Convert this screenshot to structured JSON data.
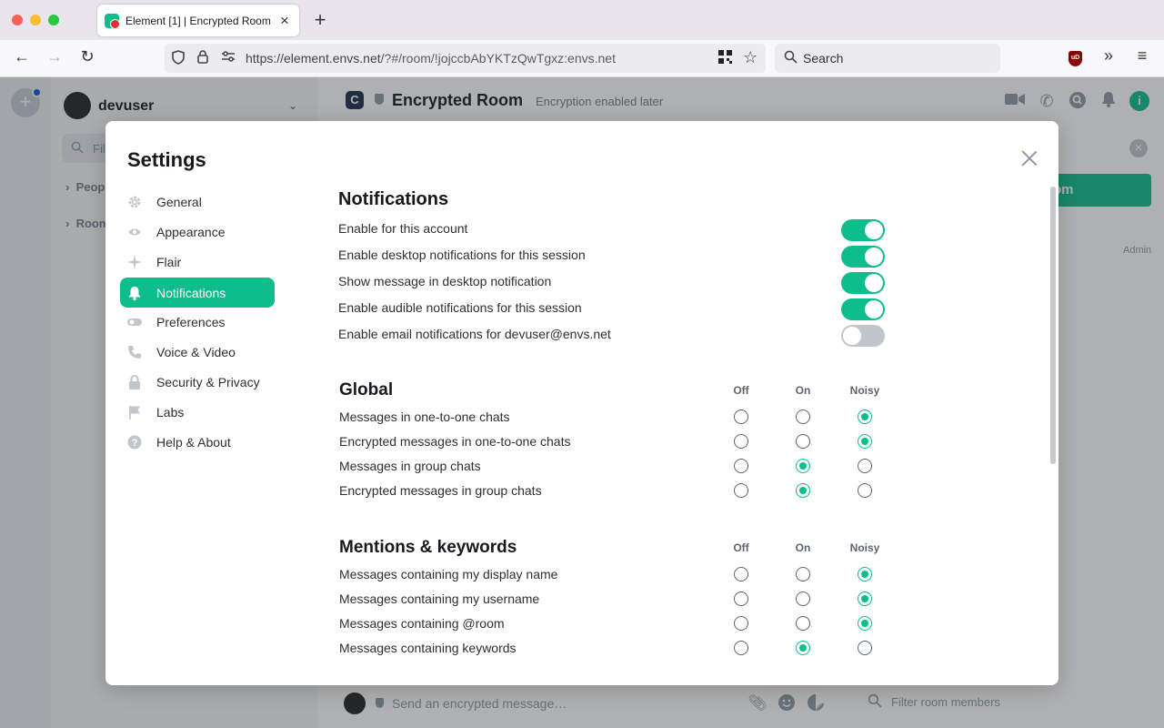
{
  "browser": {
    "tab_title": "Element [1] | Encrypted Room",
    "url_host": "https://element.envs.net",
    "url_path": "/?#/room/!jojccbAbYKTzQwTgxz:envs.net",
    "search_placeholder": "Search",
    "ublock_label": "uD"
  },
  "app": {
    "user_name": "devuser",
    "filter_placeholder": "Fil",
    "sections": [
      "Peop",
      "Room"
    ],
    "room_initial": "C",
    "room_name": "Encrypted Room",
    "room_topic": "Encryption enabled later",
    "right_button": "om",
    "admin_label": "Admin",
    "composer_placeholder": "Send an encrypted message…",
    "member_filter": "Filter room members",
    "accent": "#0dbd8b"
  },
  "dialog": {
    "title": "Settings",
    "sidebar": [
      {
        "label": "General",
        "icon": "gear-icon"
      },
      {
        "label": "Appearance",
        "icon": "eye-icon"
      },
      {
        "label": "Flair",
        "icon": "sparkle-icon"
      },
      {
        "label": "Notifications",
        "icon": "bell-icon",
        "active": true
      },
      {
        "label": "Preferences",
        "icon": "toggle-icon"
      },
      {
        "label": "Voice & Video",
        "icon": "phone-icon"
      },
      {
        "label": "Security & Privacy",
        "icon": "lock-icon"
      },
      {
        "label": "Labs",
        "icon": "flag-icon"
      },
      {
        "label": "Help & About",
        "icon": "help-icon"
      }
    ],
    "notifications": {
      "heading": "Notifications",
      "toggles": [
        {
          "label": "Enable for this account",
          "on": true
        },
        {
          "label": "Enable desktop notifications for this session",
          "on": true
        },
        {
          "label": "Show message in desktop notification",
          "on": true
        },
        {
          "label": "Enable audible notifications for this session",
          "on": true
        },
        {
          "label": "Enable email notifications for devuser@envs.net",
          "on": false
        }
      ]
    },
    "columns": [
      "Off",
      "On",
      "Noisy"
    ],
    "global": {
      "heading": "Global",
      "rows": [
        {
          "label": "Messages in one-to-one chats",
          "value": "Noisy"
        },
        {
          "label": "Encrypted messages in one-to-one chats",
          "value": "Noisy"
        },
        {
          "label": "Messages in group chats",
          "value": "On"
        },
        {
          "label": "Encrypted messages in group chats",
          "value": "On"
        }
      ]
    },
    "mentions": {
      "heading": "Mentions & keywords",
      "rows": [
        {
          "label": "Messages containing my display name",
          "value": "Noisy"
        },
        {
          "label": "Messages containing my username",
          "value": "Noisy"
        },
        {
          "label": "Messages containing @room",
          "value": "Noisy"
        },
        {
          "label": "Messages containing keywords",
          "value": "On"
        }
      ]
    }
  }
}
